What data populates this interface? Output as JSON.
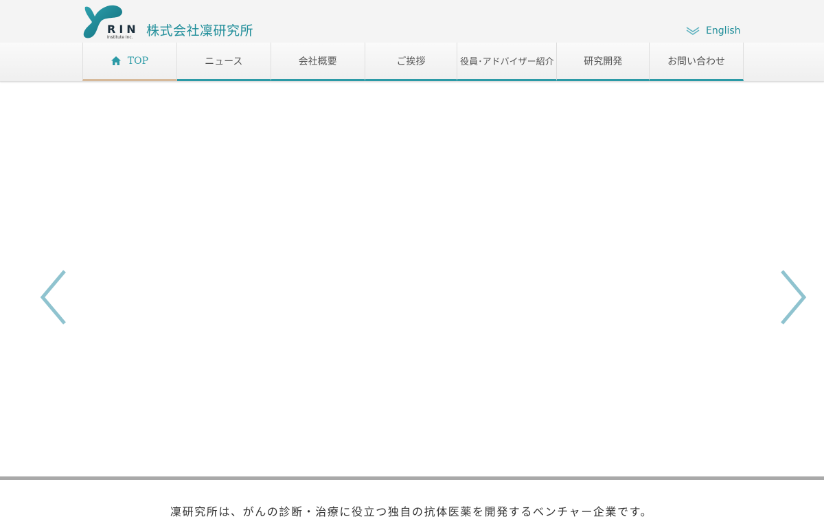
{
  "header": {
    "logo_text": "RIN",
    "logo_subtext": "Institute Inc.",
    "company_name": "株式会社凜研究所",
    "language_link": "English"
  },
  "nav": {
    "items": [
      {
        "label": "TOP",
        "icon": "home-icon",
        "active": true
      },
      {
        "label": "ニュース"
      },
      {
        "label": "会社概要"
      },
      {
        "label": "ご挨拶"
      },
      {
        "label": "役員･アドバイザー紹介"
      },
      {
        "label": "研究開発"
      },
      {
        "label": "お問い合わせ"
      }
    ]
  },
  "slider": {
    "prev_icon": "chevron-left-icon",
    "next_icon": "chevron-right-icon"
  },
  "intro": {
    "tagline": "凜研究所は、がんの診断・治療に役立つ独自の抗体医薬を開発するベンチャー企業です。"
  },
  "colors": {
    "accent": "#1e8d99",
    "nav_underline": "#2b9aa6",
    "active_underline": "#d6b99a",
    "arrow": "#8fc3cf"
  }
}
